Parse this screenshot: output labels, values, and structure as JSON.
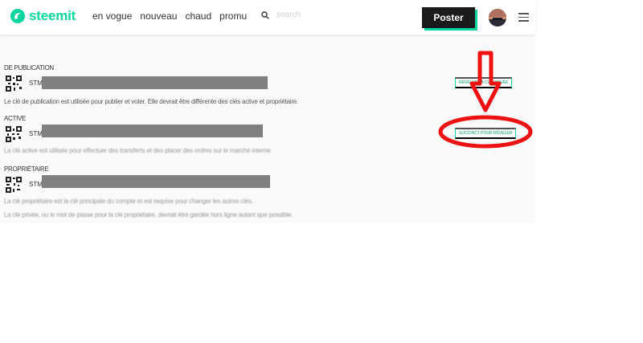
{
  "header": {
    "logo_text": "steemit",
    "nav": [
      "en vogue",
      "nouveau",
      "chaud",
      "promu"
    ],
    "search_placeholder": "search",
    "post_label": "Poster",
    "brand_color": "#07d6a0"
  },
  "keys": {
    "publication": {
      "title": "DE PUBLICATION",
      "prefix": "STM",
      "description": "Le clé de publication est utilisée pour publier et voter. Elle devrait être différente des clés active et propriétaire.",
      "reveal_label": "RÉVÉLER LA CLÉ PRIVÉE"
    },
    "active": {
      "title": "ACTIVE",
      "prefix": "STM",
      "description": "La clé active est utilisée pour effectuer des transferts et des placer des ordres sur le marché interne.",
      "reveal_label": "SUCCINCT POUR RÉVÉLER"
    },
    "owner": {
      "title": "PROPRIÉTAIRE",
      "prefix": "STM",
      "description": "La clé propriétaire est la clé principale du compte et est requise pour changer les autres clés.",
      "note": "La clé privée, ou le mot de passe pour la clé propriétaire, devrait être gardée hors ligne autant que possible."
    }
  },
  "annotation": {
    "color": "#ee1111",
    "icons": [
      "down-arrow",
      "ellipse"
    ]
  }
}
